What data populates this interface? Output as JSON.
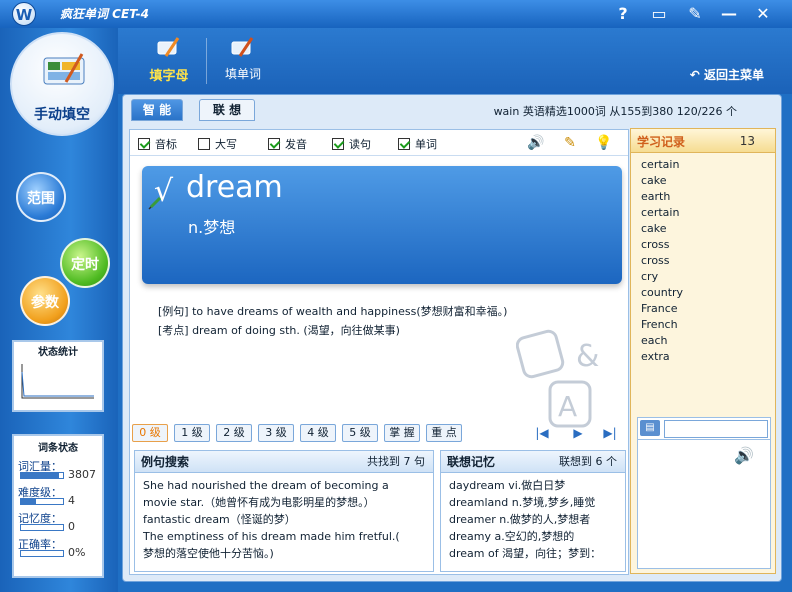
{
  "window": {
    "title": "疯狂单词 CET-4",
    "logo": "W"
  },
  "title_buttons": {
    "help": "?",
    "minimize_to_tray": "▭",
    "edit": "✎",
    "minimize": "—",
    "close": "✕"
  },
  "sidebar": {
    "mode_label": "手动填空",
    "buttons": {
      "range": "范围",
      "timer": "定时",
      "params": "参数"
    },
    "stats_title": "状态统计",
    "word_state_title": "词条状态",
    "word_state": [
      {
        "label": "词汇量：",
        "value": "3807",
        "fill": 0.9
      },
      {
        "label": "难度级：",
        "value": "4",
        "fill": 0.35
      },
      {
        "label": "记忆度：",
        "value": "0",
        "fill": 0
      },
      {
        "label": "正确率：",
        "value": "0%",
        "fill": 0
      }
    ]
  },
  "top_tabs": {
    "fill_letter": "填字母",
    "fill_word": "填单词",
    "return_main": "返回主菜单"
  },
  "subtabs": {
    "smart": "智 能",
    "assoc": "联 想"
  },
  "info_line": "wain  英语精选1000词  从155到380  120/226 个",
  "options": [
    {
      "label": "音标",
      "checked": true
    },
    {
      "label": "大写",
      "checked": false
    },
    {
      "label": "发音",
      "checked": true
    },
    {
      "label": "读句",
      "checked": true
    },
    {
      "label": "单词",
      "checked": true
    }
  ],
  "word": {
    "correct_mark": "√",
    "text": "dream",
    "meaning": "n.梦想"
  },
  "examples": {
    "line1": "[例句] to have dreams of wealth and happiness(梦想财富和幸福。)",
    "line2": "[考点] dream of doing sth. (渴望，向往做某事)"
  },
  "levels": [
    "0 级",
    "1 级",
    "2 级",
    "3 级",
    "4 级",
    "5 级",
    "掌 握",
    "重 点"
  ],
  "nav": {
    "first": "|◀",
    "play": "▶",
    "last": "▶|"
  },
  "example_search": {
    "title": "例句搜索",
    "count": "共找到 7 句",
    "lines": [
      "She had nourished the dream of becoming a",
      "movie star.（她曾怀有成为电影明星的梦想。）",
      "fantastic dream（怪诞的梦）",
      "The emptiness of his dream made him fretful.(",
      "梦想的落空使他十分苦恼。)"
    ]
  },
  "assoc_memory": {
    "title": "联想记忆",
    "count": "联想到 6 个",
    "lines": [
      "daydream  vi.做白日梦",
      "dreamland  n.梦境,梦乡,睡觉",
      "dreamer  n.做梦的人,梦想者",
      "dreamy  a.空幻的,梦想的",
      "dream of  渴望，向往；梦到："
    ]
  },
  "history": {
    "title": "学习记录",
    "count": "13",
    "items": [
      "certain",
      "cake",
      "earth",
      "certain",
      "cake",
      "cross",
      "cross",
      "cry",
      "country",
      "France",
      "French",
      "each",
      "extra"
    ]
  },
  "lookup": {
    "placeholder": ""
  }
}
